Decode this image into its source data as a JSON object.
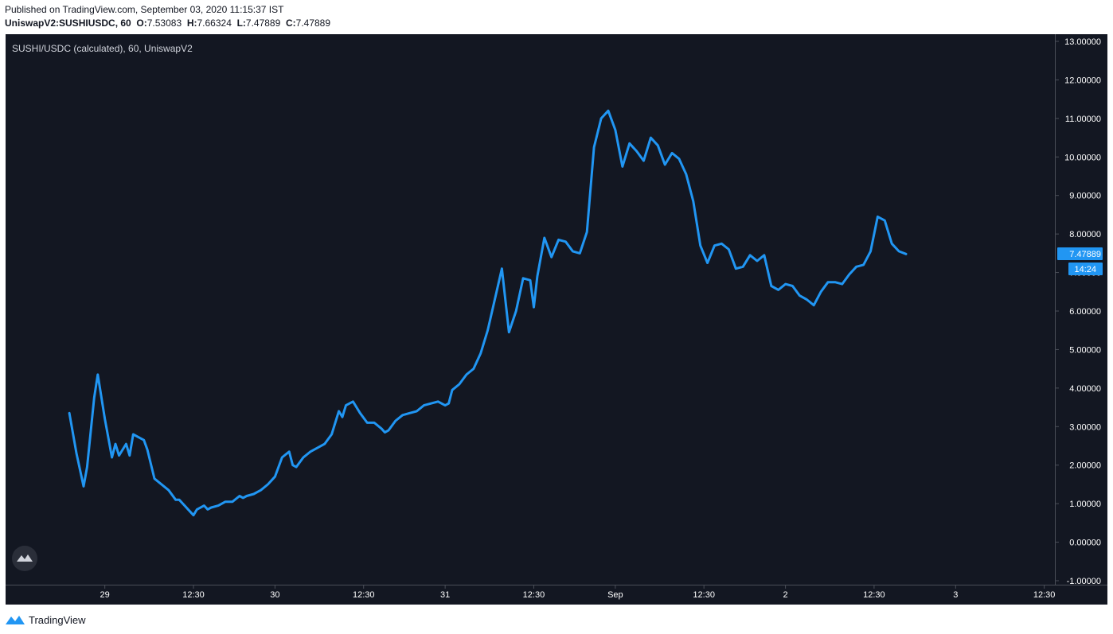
{
  "header": {
    "published": "Published on TradingView.com, September 03, 2020 11:15:37 IST",
    "symbol": "UniswapV2:SUSHIUSDC, 60",
    "ohlc": [
      {
        "label": "O:",
        "value": "7.53083"
      },
      {
        "label": "H:",
        "value": "7.66324"
      },
      {
        "label": "L:",
        "value": "7.47889"
      },
      {
        "label": "C:",
        "value": "7.47889"
      }
    ]
  },
  "footer": {
    "brand": "TradingView"
  },
  "colors": {
    "background": "#131722",
    "line": "#2196f3",
    "axis_text": "#ffffff",
    "label_bg": "#2196f3"
  },
  "chart_data": {
    "type": "line",
    "title": "SUSHI/USDC (calculated), 60, UniswapV2",
    "xlabel": "",
    "ylabel": "",
    "grid": false,
    "ylim": [
      -1,
      13
    ],
    "y_ticks": [
      {
        "value": 13,
        "label": "13.00000"
      },
      {
        "value": 12,
        "label": "12.00000"
      },
      {
        "value": 11,
        "label": "11.00000"
      },
      {
        "value": 10,
        "label": "10.00000"
      },
      {
        "value": 9,
        "label": "9.00000"
      },
      {
        "value": 8,
        "label": "8.00000"
      },
      {
        "value": 7,
        "label": "7.00000"
      },
      {
        "value": 6,
        "label": "6.00000"
      },
      {
        "value": 5,
        "label": "5.00000"
      },
      {
        "value": 4,
        "label": "4.00000"
      },
      {
        "value": 3,
        "label": "3.00000"
      },
      {
        "value": 2,
        "label": "2.00000"
      },
      {
        "value": 1,
        "label": "1.00000"
      },
      {
        "value": 0,
        "label": "0.00000"
      },
      {
        "value": -1,
        "label": "-1.00000"
      }
    ],
    "x_ticks": [
      {
        "label": "29",
        "hour": 14
      },
      {
        "label": "12:30",
        "hour": 26.5
      },
      {
        "label": "30",
        "hour": 38
      },
      {
        "label": "12:30",
        "hour": 50.5
      },
      {
        "label": "31",
        "hour": 62
      },
      {
        "label": "12:30",
        "hour": 74.5
      },
      {
        "label": "Sep",
        "hour": 86
      },
      {
        "label": "12:30",
        "hour": 98.5
      },
      {
        "label": "2",
        "hour": 110
      },
      {
        "label": "12:30",
        "hour": 122.5
      },
      {
        "label": "3",
        "hour": 134
      },
      {
        "label": "12:30",
        "hour": 146.5
      }
    ],
    "xlim": [
      0,
      148
    ],
    "series": [
      {
        "points": [
          [
            9,
            3.35
          ],
          [
            10,
            2.3
          ],
          [
            11,
            1.45
          ],
          [
            11.5,
            1.95
          ],
          [
            12.5,
            3.75
          ],
          [
            13,
            4.35
          ],
          [
            14,
            3.2
          ],
          [
            15,
            2.2
          ],
          [
            15.5,
            2.55
          ],
          [
            16,
            2.25
          ],
          [
            17,
            2.55
          ],
          [
            17.5,
            2.25
          ],
          [
            18,
            2.8
          ],
          [
            19,
            2.7
          ],
          [
            19.5,
            2.65
          ],
          [
            20,
            2.4
          ],
          [
            21,
            1.65
          ],
          [
            22,
            1.5
          ],
          [
            23,
            1.35
          ],
          [
            24,
            1.1
          ],
          [
            24.5,
            1.1
          ],
          [
            25,
            1.0
          ],
          [
            26,
            0.8
          ],
          [
            26.5,
            0.7
          ],
          [
            27,
            0.85
          ],
          [
            28,
            0.95
          ],
          [
            28.5,
            0.85
          ],
          [
            29,
            0.9
          ],
          [
            30,
            0.95
          ],
          [
            31,
            1.05
          ],
          [
            32,
            1.05
          ],
          [
            33,
            1.2
          ],
          [
            33.5,
            1.15
          ],
          [
            34,
            1.2
          ],
          [
            35,
            1.25
          ],
          [
            36,
            1.35
          ],
          [
            37,
            1.5
          ],
          [
            38,
            1.7
          ],
          [
            39,
            2.2
          ],
          [
            40,
            2.35
          ],
          [
            40.5,
            2.0
          ],
          [
            41,
            1.95
          ],
          [
            42,
            2.2
          ],
          [
            43,
            2.35
          ],
          [
            44,
            2.45
          ],
          [
            45,
            2.55
          ],
          [
            46,
            2.8
          ],
          [
            47,
            3.4
          ],
          [
            47.5,
            3.25
          ],
          [
            48,
            3.55
          ],
          [
            49,
            3.65
          ],
          [
            50,
            3.35
          ],
          [
            51,
            3.1
          ],
          [
            52,
            3.1
          ],
          [
            53,
            2.95
          ],
          [
            53.5,
            2.85
          ],
          [
            54,
            2.9
          ],
          [
            55,
            3.15
          ],
          [
            56,
            3.3
          ],
          [
            57,
            3.35
          ],
          [
            58,
            3.4
          ],
          [
            59,
            3.55
          ],
          [
            60,
            3.6
          ],
          [
            61,
            3.65
          ],
          [
            62,
            3.55
          ],
          [
            62.5,
            3.6
          ],
          [
            63,
            3.95
          ],
          [
            64,
            4.1
          ],
          [
            65,
            4.35
          ],
          [
            66,
            4.5
          ],
          [
            67,
            4.9
          ],
          [
            68,
            5.5
          ],
          [
            69,
            6.3
          ],
          [
            70,
            7.1
          ],
          [
            71,
            5.45
          ],
          [
            72,
            6.0
          ],
          [
            73,
            6.85
          ],
          [
            74,
            6.8
          ],
          [
            74.5,
            6.1
          ],
          [
            75,
            6.9
          ],
          [
            76,
            7.9
          ],
          [
            77,
            7.4
          ],
          [
            78,
            7.85
          ],
          [
            79,
            7.8
          ],
          [
            80,
            7.55
          ],
          [
            81,
            7.5
          ],
          [
            82,
            8.05
          ],
          [
            83,
            10.25
          ],
          [
            84,
            11.0
          ],
          [
            85,
            11.2
          ],
          [
            86,
            10.7
          ],
          [
            87,
            9.75
          ],
          [
            88,
            10.35
          ],
          [
            89,
            10.15
          ],
          [
            90,
            9.9
          ],
          [
            91,
            10.5
          ],
          [
            92,
            10.3
          ],
          [
            93,
            9.8
          ],
          [
            94,
            10.1
          ],
          [
            95,
            9.95
          ],
          [
            96,
            9.55
          ],
          [
            97,
            8.85
          ],
          [
            98,
            7.7
          ],
          [
            99,
            7.25
          ],
          [
            100,
            7.7
          ],
          [
            101,
            7.75
          ],
          [
            102,
            7.6
          ],
          [
            103,
            7.1
          ],
          [
            104,
            7.15
          ],
          [
            105,
            7.45
          ],
          [
            106,
            7.3
          ],
          [
            107,
            7.45
          ],
          [
            108,
            6.65
          ],
          [
            109,
            6.55
          ],
          [
            110,
            6.7
          ],
          [
            111,
            6.65
          ],
          [
            112,
            6.4
          ],
          [
            113,
            6.3
          ],
          [
            114,
            6.15
          ],
          [
            115,
            6.5
          ],
          [
            116,
            6.75
          ],
          [
            117,
            6.75
          ],
          [
            118,
            6.7
          ],
          [
            119,
            6.95
          ],
          [
            120,
            7.15
          ],
          [
            121,
            7.2
          ],
          [
            122,
            7.55
          ],
          [
            123,
            8.45
          ],
          [
            124,
            8.35
          ],
          [
            125,
            7.75
          ],
          [
            126,
            7.55
          ],
          [
            127,
            7.48
          ]
        ]
      }
    ],
    "last_price_label": "7.47889",
    "countdown_label": "14:24"
  }
}
